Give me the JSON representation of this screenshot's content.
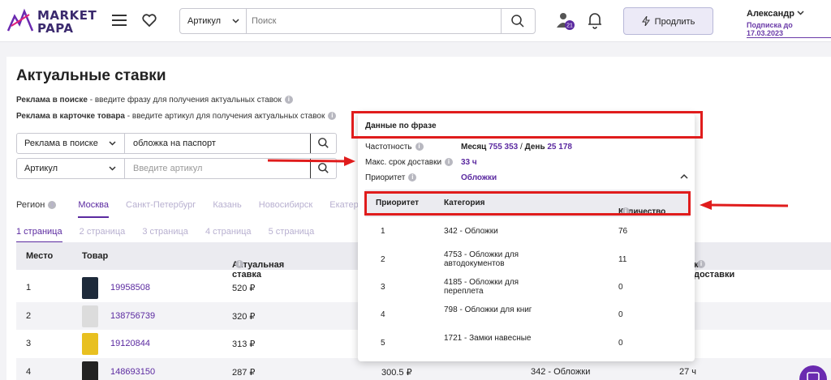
{
  "header": {
    "logo_text_line1": "MARKET",
    "logo_text_line2": "PAPA",
    "search_select": "Артикул",
    "search_placeholder": "Поиск",
    "badge": "21",
    "prolong_label": "Продлить",
    "user_name": "Александр",
    "subscription": "Подписка до 17.03.2023"
  },
  "page": {
    "title": "Актуальные ставки",
    "hint1_bold": "Реклама в поиске",
    "hint1_text": " - введите фразу для получения актуальных ставок",
    "hint2_bold": "Реклама в карточке товара",
    "hint2_text": " - введите артикул для получения актуальных ставок",
    "form1_select": "Реклама в поиске",
    "form1_value": "обложка на паспорт",
    "form2_select": "Артикул",
    "form2_placeholder": "Введите артикул"
  },
  "regions": {
    "label": "Регион",
    "items": [
      "Москва",
      "Санкт-Петербург",
      "Казань",
      "Новосибирск",
      "Екатер"
    ]
  },
  "pages": [
    "1 страница",
    "2 страница",
    "3 страница",
    "4 страница",
    "5 страница"
  ],
  "table": {
    "headers": [
      "Место",
      "Товар",
      "Актуальная ставка",
      "к доставки"
    ],
    "rows": [
      {
        "place": "1",
        "article": "19958508",
        "bid": "520 ₽"
      },
      {
        "place": "2",
        "article": "138756739",
        "bid": "320 ₽"
      },
      {
        "place": "3",
        "article": "19120844",
        "bid": "313 ₽"
      },
      {
        "place": "4",
        "article": "148693150",
        "bid": "287 ₽",
        "extra1": "300.5 ₽",
        "extra2": "342 - Обложки",
        "extra3": "27 ч"
      }
    ]
  },
  "popup": {
    "title": "Данные по фразе",
    "freq_label": "Частотность",
    "freq_month_label": "Месяц",
    "freq_month": "755 353",
    "freq_sep": "/",
    "freq_day_label": "День",
    "freq_day": "25 178",
    "delivery_label": "Макс. срок доставки",
    "delivery_value": "33 ч",
    "priority_label": "Приоритет",
    "priority_value": "Обложки",
    "headers": [
      "Приоритет",
      "Категория",
      "Количество"
    ],
    "rows": [
      {
        "priority": "1",
        "category": "342 - Обложки",
        "count": "76"
      },
      {
        "priority": "2",
        "category": "4753 - Обложки для автодокументов",
        "count": "11"
      },
      {
        "priority": "3",
        "category": "4185 - Обложки для переплета",
        "count": "0"
      },
      {
        "priority": "4",
        "category": "798 - Обложки для книг",
        "count": "0"
      },
      {
        "priority": "5",
        "category": "1721 - Замки навесные",
        "count": "0"
      }
    ]
  },
  "colors": {
    "accent": "#5b2aa0",
    "highlight": "#e01c1c"
  },
  "icons": [
    "logo-icon",
    "burger-icon",
    "heart-icon",
    "chevron-down-icon",
    "search-icon",
    "user-icon",
    "bell-icon",
    "lightning-icon",
    "info-icon",
    "chat-icon"
  ]
}
